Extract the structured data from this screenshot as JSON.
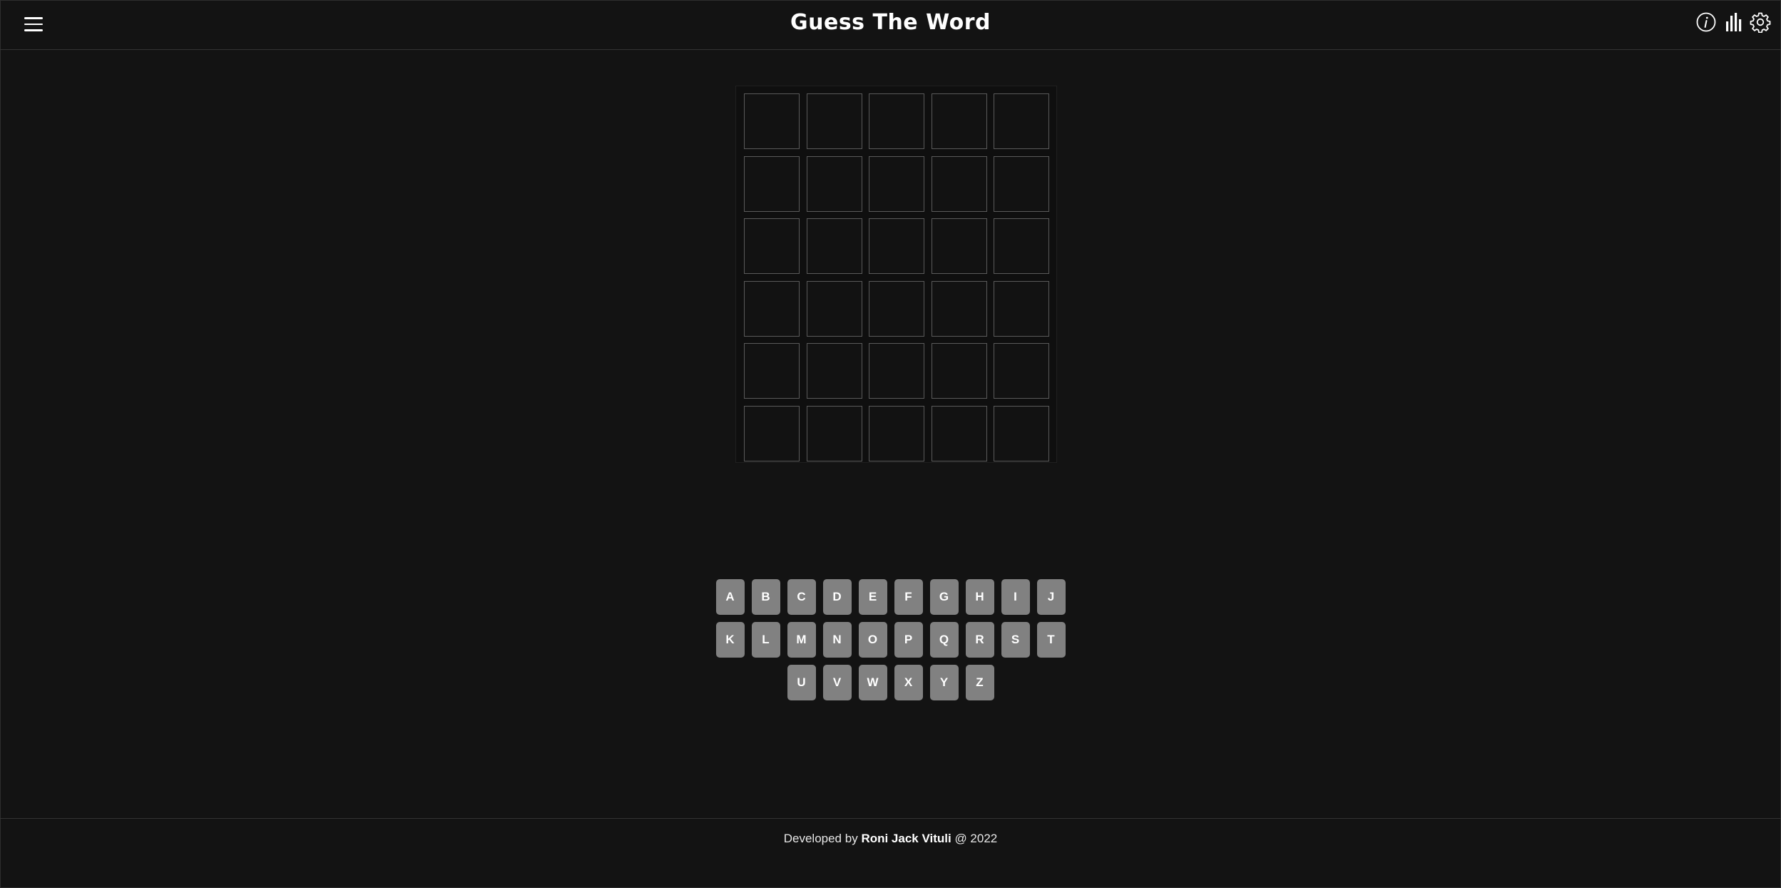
{
  "header": {
    "title": "Guess The Word",
    "icons": [
      "menu-icon",
      "info-icon",
      "stats-icon",
      "settings-icon"
    ]
  },
  "board": {
    "rows": 6,
    "cols": 5,
    "tiles": [
      [
        "",
        "",
        "",
        "",
        ""
      ],
      [
        "",
        "",
        "",
        "",
        ""
      ],
      [
        "",
        "",
        "",
        "",
        ""
      ],
      [
        "",
        "",
        "",
        "",
        ""
      ],
      [
        "",
        "",
        "",
        "",
        ""
      ],
      [
        "",
        "",
        "",
        "",
        ""
      ]
    ]
  },
  "keyboard": {
    "rows": [
      [
        "A",
        "B",
        "C",
        "D",
        "E",
        "F",
        "G",
        "H",
        "I",
        "J"
      ],
      [
        "K",
        "L",
        "M",
        "N",
        "O",
        "P",
        "Q",
        "R",
        "S",
        "T"
      ],
      [
        "U",
        "V",
        "W",
        "X",
        "Y",
        "Z"
      ]
    ]
  },
  "footer": {
    "prefix": "Developed by",
    "author": "Roni Jack Vituli",
    "suffix": "@ 2022"
  },
  "colors": {
    "background": "#131313",
    "tile_border": "#5a5a5a",
    "key_bg": "#818181",
    "text": "#ffffff"
  }
}
